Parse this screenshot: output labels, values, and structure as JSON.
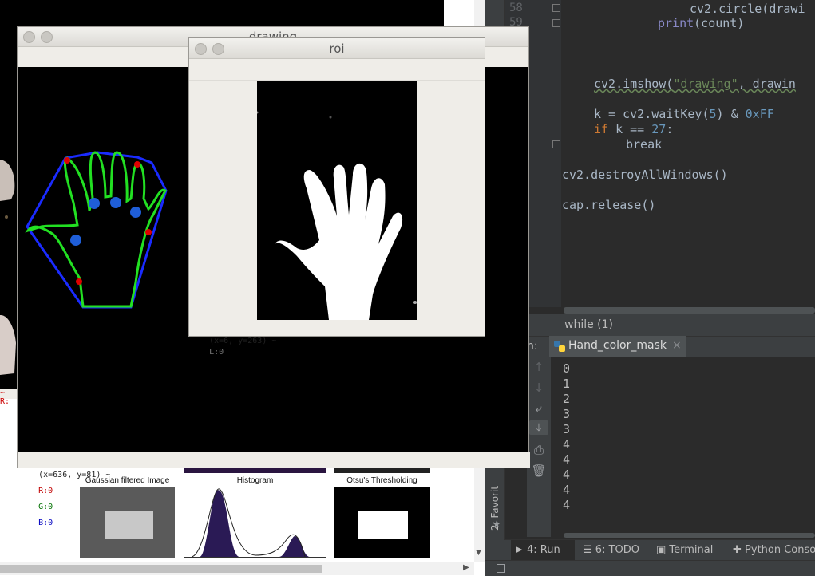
{
  "ide": {
    "line_numbers": [
      "58",
      "59"
    ],
    "code": {
      "l58_fn": "cv2.circle(drawi",
      "l59_print": "print",
      "l59_args": "(count)",
      "imshow_fn": "cv2.imshow(",
      "imshow_str": "\"drawing\"",
      "imshow_rest": ", drawin",
      "waitkey_a": "k = cv2.waitKey(",
      "waitkey_num": "5",
      "waitkey_b": ") & ",
      "waitkey_hex": "0xFF",
      "if_kw": "if",
      "if_a": " k == ",
      "if_num": "27",
      "if_b": ":",
      "break_kw": "break",
      "destroy": "cv2.destroyAllWindows()",
      "release": "cap.release()"
    },
    "breadcrumb": "while (1)",
    "run_tab_prefix": "n:",
    "run_tab_name": "Hand_color_mask",
    "run_tab_close": "×",
    "console_lines": [
      "0",
      "1",
      "2",
      "3",
      "3",
      "4",
      "4",
      "4",
      "4",
      "4"
    ],
    "sidebar_label": "2: Favorit",
    "bottom_tabs": [
      {
        "label": "4: Run"
      },
      {
        "label": "6: TODO"
      },
      {
        "label": "Terminal"
      },
      {
        "label": "Python Consol"
      }
    ]
  },
  "web": {
    "figure_labels": [
      "Gaussian filtered Image",
      "Histogram",
      "Otsu's Thresholding"
    ]
  },
  "drawing_window": {
    "title": "drawing",
    "status_coords": "(x=636, y=81) ~",
    "status_r": "R:0",
    "status_g": "G:0",
    "status_b": "B:0"
  },
  "roi_window": {
    "title": "roi",
    "status_coords": "(x=6, y=263) ~",
    "status_l": "L:0"
  },
  "behind_window": {
    "status_r": "~ R:"
  },
  "colors": {
    "hull": "#1a2bff",
    "contour": "#22e022",
    "defects_red": "#e00000",
    "defects_blue": "#1f5ed8",
    "ide_bg": "#2b2b2b"
  }
}
